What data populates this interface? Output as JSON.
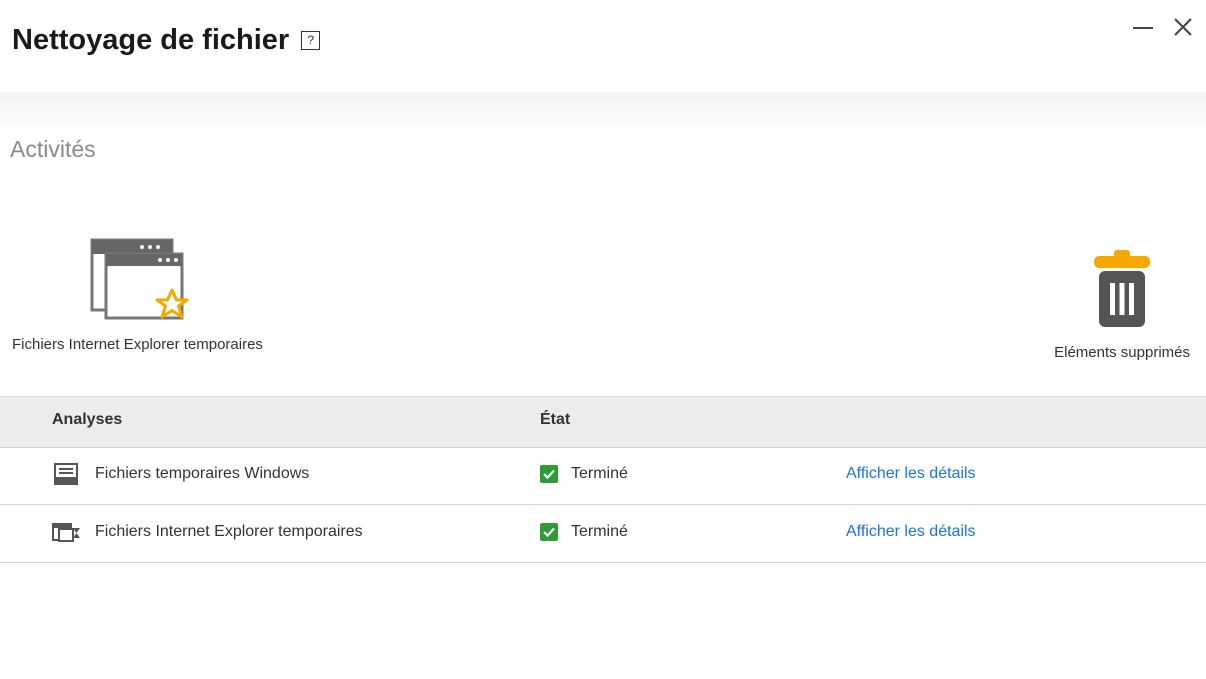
{
  "window": {
    "title": "Nettoyage de fichier",
    "help_icon": "?",
    "controls": [
      "minimize-icon",
      "close-icon"
    ]
  },
  "section": {
    "title": "Activités"
  },
  "activities": [
    {
      "label": "Fichiers Internet Explorer temporaires",
      "icon": "browser-windows-star-icon"
    },
    {
      "label": "Eléments supprimés",
      "icon": "trash-bin-icon",
      "accent": "#f5a800"
    }
  ],
  "table": {
    "columns": [
      "Analyses",
      "État"
    ],
    "rows": [
      {
        "name": "Fichiers temporaires Windows",
        "icon": "windows-temp-files-icon",
        "status": "Terminé",
        "action": "Afficher les détails"
      },
      {
        "name": "Fichiers Internet Explorer temporaires",
        "icon": "ie-temp-files-icon",
        "status": "Terminé",
        "action": "Afficher les détails"
      }
    ]
  },
  "colors": {
    "status_ok": "#2e9b35",
    "link": "#1a73e8",
    "trash_lid": "#f5a800"
  }
}
